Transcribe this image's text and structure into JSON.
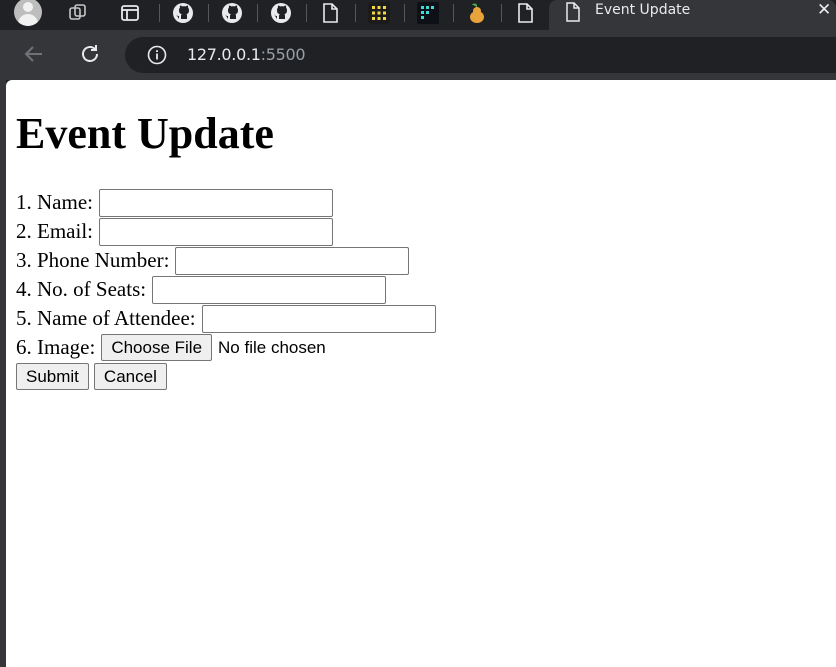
{
  "browser": {
    "active_tab_title": "Event Update",
    "tab_close_glyph": "✕",
    "url_host": "127.0.0.1",
    "url_port": ":5500",
    "pinned_tab_icons": [
      "tab-groups-icon",
      "sidebar-icon",
      "github-icon",
      "github-icon",
      "github-icon",
      "document-icon",
      "grid-app-icon",
      "grid-app-icon",
      "pear-icon",
      "document-icon"
    ]
  },
  "page": {
    "heading": "Event Update",
    "fields": [
      {
        "label": "1. Name:"
      },
      {
        "label": "2. Email:"
      },
      {
        "label": "3. Phone Number:"
      },
      {
        "label": "4. No. of Seats:"
      },
      {
        "label": "5. Name of Attendee:"
      }
    ],
    "image_label": "6. Image:",
    "file_button": "Choose File",
    "file_status": "No file chosen",
    "submit_label": "Submit",
    "cancel_label": "Cancel"
  }
}
